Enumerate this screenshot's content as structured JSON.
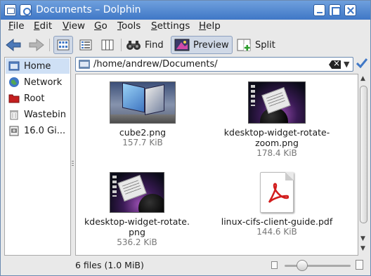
{
  "window": {
    "title": "Documents – Dolphin"
  },
  "menu": [
    "File",
    "Edit",
    "View",
    "Go",
    "Tools",
    "Settings",
    "Help"
  ],
  "toolbar": {
    "find_label": "Find",
    "preview_label": "Preview",
    "split_label": "Split"
  },
  "places": [
    {
      "label": "Home",
      "icon": "home-icon",
      "selected": true
    },
    {
      "label": "Network",
      "icon": "network-icon",
      "selected": false
    },
    {
      "label": "Root",
      "icon": "root-folder-icon",
      "selected": false
    },
    {
      "label": "Wastebin",
      "icon": "trash-icon",
      "selected": false
    },
    {
      "label": "16.0 Gi...",
      "icon": "drive-icon",
      "selected": false
    }
  ],
  "location": {
    "path": "/home/andrew/Documents/"
  },
  "files": [
    {
      "name": "cube2.png",
      "size": "157.7 KiB",
      "thumb": "cube-screenshot"
    },
    {
      "name": "kdesktop-widget-rotate-zoom.png",
      "name_lines": [
        "kdesktop-widget-rotate-",
        "zoom.png"
      ],
      "size": "178.4 KiB",
      "thumb": "desktop-screenshot"
    },
    {
      "name": "kdesktop-widget-rotate.png",
      "name_lines": [
        "kdesktop-widget-rotate.",
        "png"
      ],
      "size": "536.2 KiB",
      "thumb": "desktop-screenshot"
    },
    {
      "name": "linux-cifs-client-guide.pdf",
      "size": "144.6 KiB",
      "thumb": "pdf-icon"
    }
  ],
  "status": {
    "text": "6 files (1.0 MiB)"
  },
  "zoom": {
    "level": 0.25
  },
  "colors": {
    "titlebar": "#3f77c6",
    "selection": "#cfe0f5",
    "pdf_red": "#d21c1c"
  }
}
